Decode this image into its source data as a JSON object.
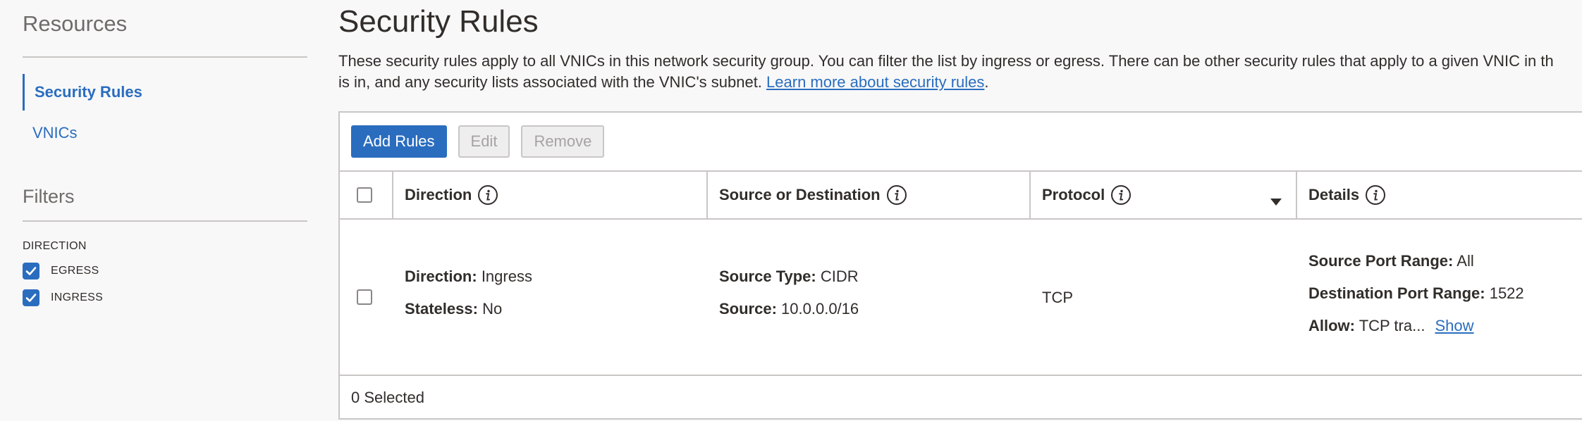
{
  "sidebar": {
    "resources_title": "Resources",
    "nav": [
      {
        "label": "Security Rules",
        "active": true
      },
      {
        "label": "VNICs",
        "active": false
      }
    ],
    "filters_title": "Filters",
    "direction_label": "DIRECTION",
    "filter_options": [
      {
        "label": "EGRESS",
        "checked": true
      },
      {
        "label": "INGRESS",
        "checked": true
      }
    ]
  },
  "main": {
    "title": "Security Rules",
    "description_line1": "These security rules apply to all VNICs in this network security group. You can filter the list by ingress or egress. There can be other security rules that apply to a given VNIC in th",
    "description_line2_prefix": "is in, and any security lists associated with the VNIC's subnet. ",
    "description_link": "Learn more about security rules",
    "description_line2_suffix": "."
  },
  "toolbar": {
    "add_label": "Add Rules",
    "edit_label": "Edit",
    "remove_label": "Remove"
  },
  "table": {
    "headers": {
      "direction": "Direction",
      "source_dest": "Source or Destination",
      "protocol": "Protocol",
      "details": "Details"
    },
    "rows": [
      {
        "direction_key": "Direction:",
        "direction_val": "Ingress",
        "stateless_key": "Stateless:",
        "stateless_val": "No",
        "source_type_key": "Source Type:",
        "source_type_val": "CIDR",
        "source_key": "Source:",
        "source_val": "10.0.0.0/16",
        "protocol": "TCP",
        "src_port_key": "Source Port Range:",
        "src_port_val": "All",
        "dst_port_key": "Destination Port Range:",
        "dst_port_val": "1522",
        "allow_key": "Allow:",
        "allow_val": "TCP tra...",
        "show_link": "Show"
      }
    ]
  },
  "footer": {
    "selected_text": "0 Selected"
  },
  "colors": {
    "accent": "#2a6dbf",
    "text": "#312d2a",
    "muted": "#6f6b68",
    "border": "#c9c7c5"
  }
}
